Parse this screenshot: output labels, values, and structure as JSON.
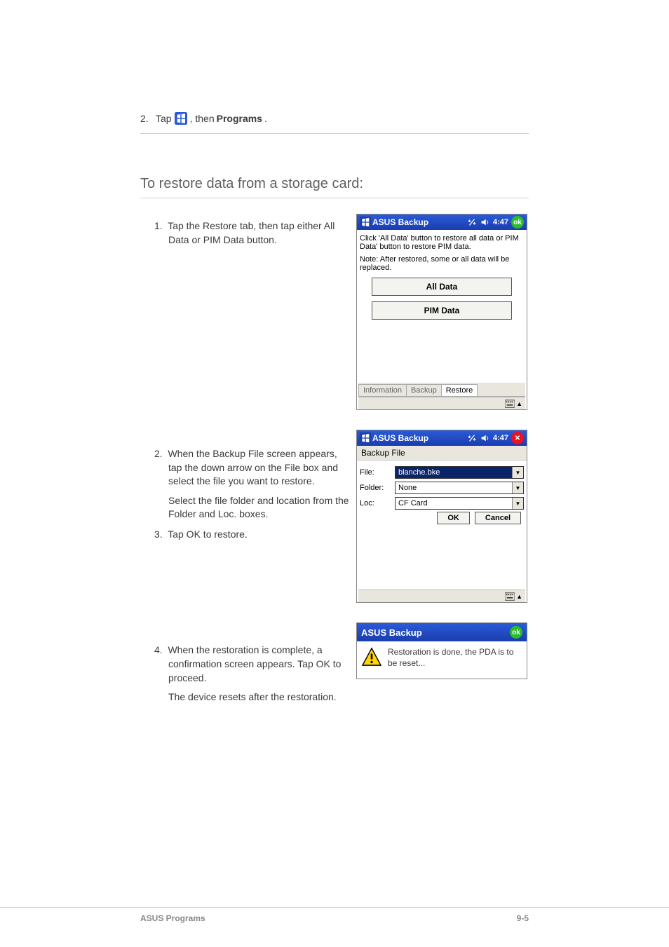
{
  "doc": {
    "step2_num": "2.",
    "step2_a": "Tap ",
    "step2_b": ", then ",
    "step2_c": "Programs",
    "step2_d": ".",
    "section_title": "To restore data from a storage card:",
    "step1_num": "1.",
    "step1_text": "Tap the Restore tab, then tap either All Data or PIM Data button.",
    "step2b_num": "2.",
    "step2b_text": "When the Backup File screen appears, tap the down arrow on the File box and select the file you want to restore.",
    "select_text": "Select the file folder and location from the Folder and Loc. boxes.",
    "step3_num": "3.",
    "step3_text": "Tap OK to restore.",
    "step4_num": "4.",
    "step4_text": "When the restoration is complete, a confirmation screen appears. Tap OK to proceed.",
    "note": "The device resets after the restoration."
  },
  "pda1": {
    "title": "ASUS Backup",
    "time": "4:47",
    "ok": "ok",
    "body1": "Click 'All Data' button to restore all data or PIM Data' button to restore PIM data.",
    "body2": "Note: After restored, some or all data will be replaced.",
    "btn_all": "All Data",
    "btn_pim": "PIM Data",
    "tab1": "Information",
    "tab2": "Backup",
    "tab3": "Restore"
  },
  "pda2": {
    "title": "ASUS Backup",
    "time": "4:47",
    "subtitle": "Backup File",
    "lbl_file": "File:",
    "val_file": "blanche.bke",
    "lbl_folder": "Folder:",
    "val_folder": "None",
    "lbl_loc": "Loc:",
    "val_loc": "CF Card",
    "btn_ok": "OK",
    "btn_cancel": "Cancel"
  },
  "dlg": {
    "title": "ASUS Backup",
    "ok": "ok",
    "msg": "Restoration is done, the PDA is to be reset..."
  },
  "footer": {
    "title": "ASUS Programs",
    "page": "9-5"
  }
}
